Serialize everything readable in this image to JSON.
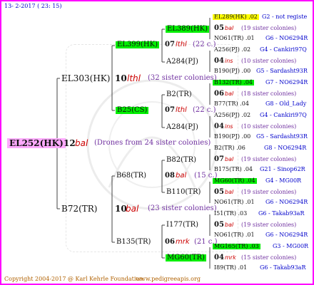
{
  "header": {
    "date": "13-  2-2017 ( 23: 15)"
  },
  "footer": {
    "copyright": "Copyright 2004-2017 @ Karl Kehrle Foundation.",
    "site": "www.pedigreeapis.org"
  },
  "root": {
    "id": "EL252(HK)",
    "gen": "12",
    "mark": "bal",
    "note": "(Drones from 24 sister colonies)"
  },
  "g1": [
    {
      "id": "EL303(HK)",
      "gen": "10",
      "mark": "lthl",
      "note": "(32 sister colonies)"
    },
    {
      "id": "B72(TR)",
      "gen": "10",
      "mark": "bal",
      "note": "(23 sister colonies)"
    }
  ],
  "g2": [
    {
      "id": "EL399(HK)",
      "gen": "07",
      "mark": "lthl",
      "note": "(22 c.)"
    },
    {
      "id": "B25(CS)",
      "gen": "07",
      "mark": "lthl",
      "note": "(22 c.)"
    },
    {
      "id": "B68(TR)",
      "gen": "08",
      "mark": "bal",
      "note": "(15 c.)"
    },
    {
      "id": "B135(TR)",
      "gen": "06",
      "mark": "mrk",
      "note": "(21 c.)"
    }
  ],
  "g3": [
    "EL389(HK)",
    "A284(PJ)",
    "B2(TR)",
    "A284(PJ)",
    "B82(TR)",
    "B110(TR)",
    "I177(TR)",
    "MG60(TR)"
  ],
  "g4": [
    {
      "a": "EL289(HK) .02",
      "a_src": "G2 - not registe",
      "gen": "05",
      "mark": "bal",
      "note": "(19 sister colonies)",
      "b": "NO61(TR) .01",
      "b_src": "G6 - NO6294R"
    },
    {
      "a": "A256(PJ) .02",
      "a_src": "G4 - Cankiri97Q",
      "gen": "04",
      "mark": "ins",
      "note": "(10 sister colonies)",
      "b": "B190(PJ) .00",
      "b_src": "G5 - Sardasht93R"
    },
    {
      "a": "B132(TR) .04",
      "a_src": "G7 - NO6294R",
      "gen": "06",
      "mark": "bal",
      "note": "(18 sister colonies)",
      "b": "B77(TR) .04",
      "b_src": "G8 - Old_Lady"
    },
    {
      "a": "A256(PJ) .02",
      "a_src": "G4 - Cankiri97Q",
      "gen": "04",
      "mark": "ins",
      "note": "(10 sister colonies)",
      "b": "B190(PJ) .00",
      "b_src": "G5 - Sardasht93R"
    },
    {
      "a": "B2(TR) .06",
      "a_src": "G8 - NO6294R",
      "gen": "07",
      "mark": "bal",
      "note": "(19 sister colonies)",
      "b": "B175(TR) .04",
      "b_src": "G21 - Sinop62R"
    },
    {
      "a": "MG60(TR) .04",
      "a_src": "G4 - MG00R",
      "gen": "05",
      "mark": "bal",
      "note": "(19 sister colonies)",
      "b": "NO61(TR) .01",
      "b_src": "G6 - NO6294R"
    },
    {
      "a": "I51(TR) .03",
      "a_src": "G6 - Takab93aR",
      "gen": "05",
      "mark": "bal",
      "note": "(19 sister colonies)",
      "b": "NO61(TR) .01",
      "b_src": "G6 - NO6294R"
    },
    {
      "a": "MG165(TR) .03",
      "a_src": "G3 - MG00R",
      "gen": "04",
      "mark": "mrk",
      "note": "(15 sister colonies)",
      "b": "I89(TR) .01",
      "b_src": "G6 - Takab93aR"
    }
  ]
}
